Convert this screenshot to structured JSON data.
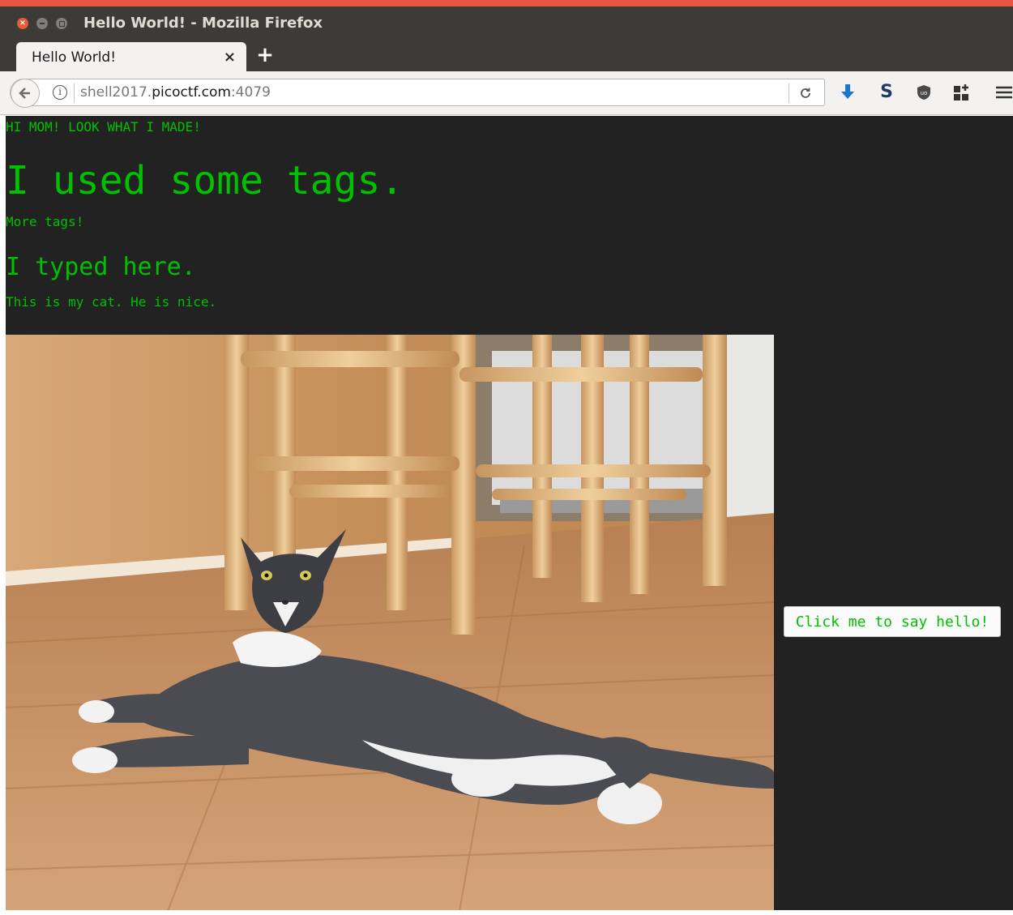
{
  "window": {
    "title": "Hello World! - Mozilla Firefox",
    "close_glyph": "×"
  },
  "tab": {
    "title": "Hello World!",
    "close_glyph": "×",
    "new_tab_glyph": "+"
  },
  "navbar": {
    "back_glyph": "←",
    "info_glyph": "i",
    "url_prefix": "shell2017.",
    "url_domain": "picoctf.com",
    "url_port": ":4079",
    "reload_glyph": "C",
    "toolbar_icons": [
      "download-icon",
      "s-extension-icon",
      "ublock-shield-icon",
      "extensions-icon",
      "hamburger-menu-icon"
    ],
    "download_glyph": "⬇",
    "s_glyph": "S",
    "shield_glyph": "⛊",
    "ext_glyph": "▦",
    "menu_glyph": "≡"
  },
  "page": {
    "line1": "HI MOM! LOOK WHAT I MADE!",
    "heading1": "I used some tags.",
    "line2": "More tags!",
    "heading2": "I typed here.",
    "line3": "This is my cat. He is nice.",
    "button_label": "Click me to say hello!",
    "text_color": "#00c000",
    "background_color": "#222222"
  }
}
